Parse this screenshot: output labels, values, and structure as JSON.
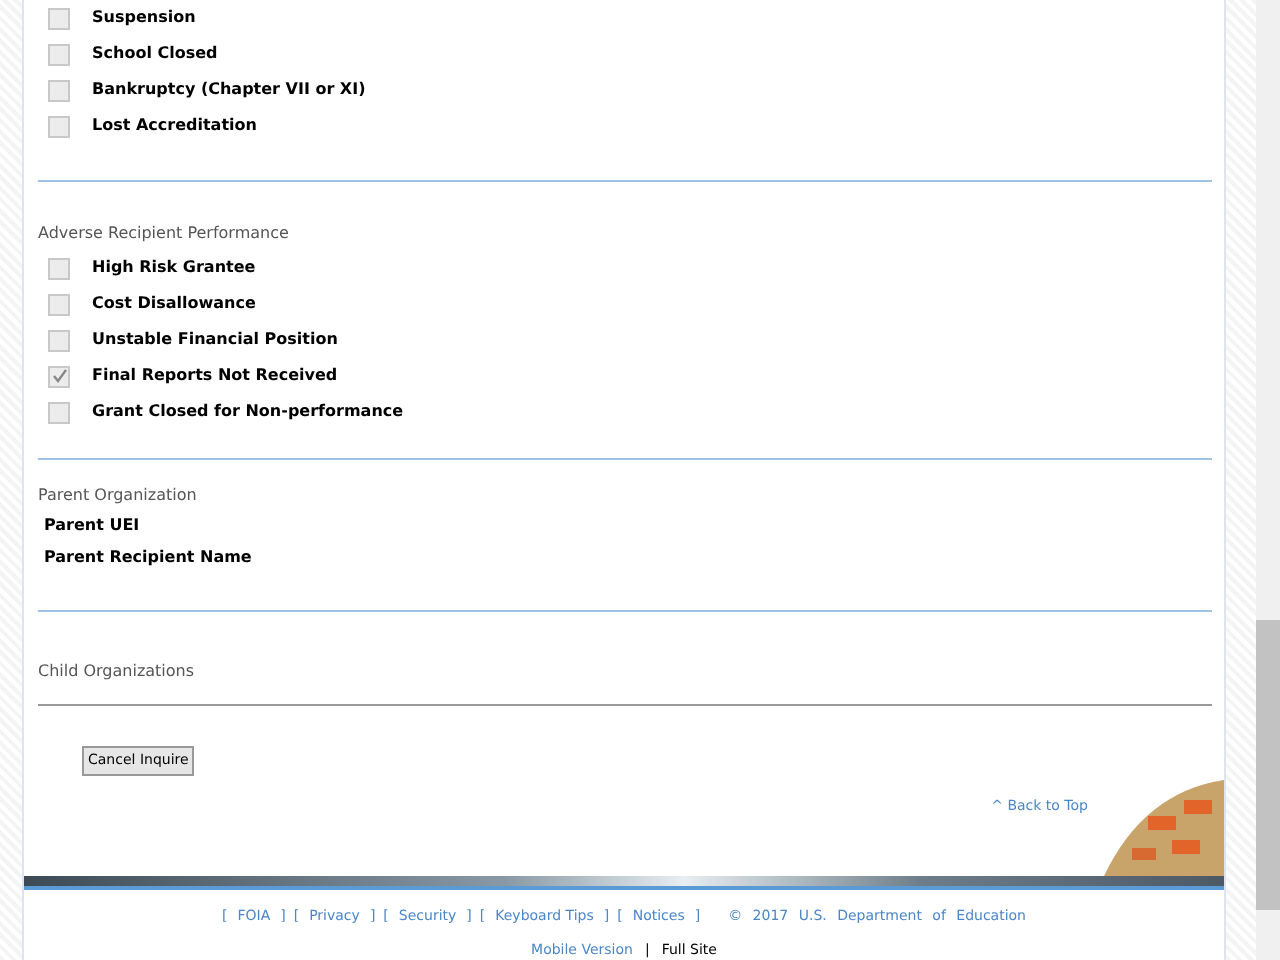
{
  "sections": [
    {
      "items": [
        {
          "label": "Suspension",
          "checked": false
        },
        {
          "label": "School Closed",
          "checked": false
        },
        {
          "label": "Bankruptcy (Chapter VII or XI)",
          "checked": false
        },
        {
          "label": "Lost Accreditation",
          "checked": false
        }
      ]
    },
    {
      "title": "Adverse Recipient Performance",
      "items": [
        {
          "label": "High Risk Grantee",
          "checked": false
        },
        {
          "label": "Cost Disallowance",
          "checked": false
        },
        {
          "label": "Unstable Financial Position",
          "checked": false
        },
        {
          "label": "Final Reports Not Received",
          "checked": true
        },
        {
          "label": "Grant Closed for Non-performance",
          "checked": false
        }
      ]
    }
  ],
  "parent_organization": {
    "title": "Parent Organization",
    "fields": [
      "Parent UEI",
      "Parent Recipient Name"
    ]
  },
  "child_organizations": {
    "title": "Child Organizations"
  },
  "cancel_button": "Cancel Inquire",
  "back_to_top": "^ Back to Top",
  "footer_links": [
    {
      "open": "[",
      "label": "FOIA",
      "close": "]"
    },
    {
      "open": "[",
      "label": "Privacy",
      "close": "]"
    },
    {
      "open": "[",
      "label": "Security",
      "close": "]"
    },
    {
      "open": "[",
      "label": "Keyboard Tips",
      "close": "]"
    },
    {
      "open": "[",
      "label": "Notices",
      "close": "]"
    }
  ],
  "copyright": "© 2017 U.S. Department of Education",
  "site_links": [
    {
      "label": "Mobile Version",
      "selected": false
    },
    {
      "label": "|",
      "kind": "separator"
    },
    {
      "label": "Full Site",
      "selected": true
    }
  ]
}
